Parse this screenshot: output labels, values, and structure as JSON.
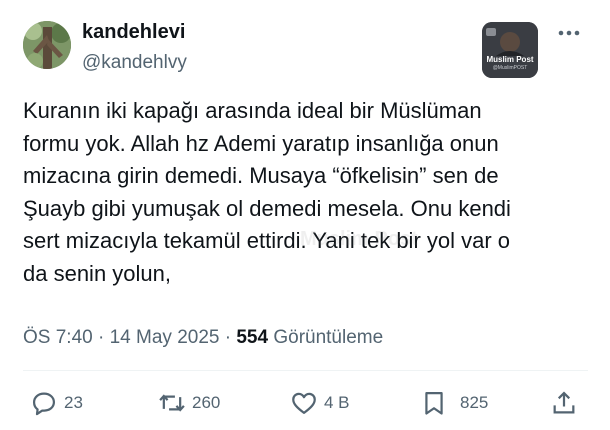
{
  "author": {
    "display_name": "kandehlevi",
    "handle": "@kandehlvy"
  },
  "badge": {
    "title": "Muslim Post",
    "subtitle": "@MuslimPOST"
  },
  "tweet": {
    "text": "Kuranın iki kapağı arasında ideal bir Müslüman\nformu yok. Allah hz Ademi yaratıp insanlığa onun\nmizacına girin demedi. Musaya “öfkelisin” sen de\nŞuayb gibi yumuşak ol demedi mesela. Onu kendi\nsert mizacıyla tekamül ettirdi. Yani tek bir yol var o\nda senin yolun,",
    "time": "ÖS 7:40",
    "date": "14 May 2025",
    "views": "554",
    "views_label": "Görüntüleme",
    "watermark": "Muslim Post"
  },
  "actions": {
    "replies": "23",
    "reposts": "260",
    "likes": "4 B",
    "bookmarks": "825"
  },
  "icons": [
    "more-icon",
    "reply-icon",
    "repost-icon",
    "like-icon",
    "bookmark-icon",
    "share-icon"
  ],
  "colors": {
    "text": "#0f1419",
    "secondary": "#536471"
  }
}
